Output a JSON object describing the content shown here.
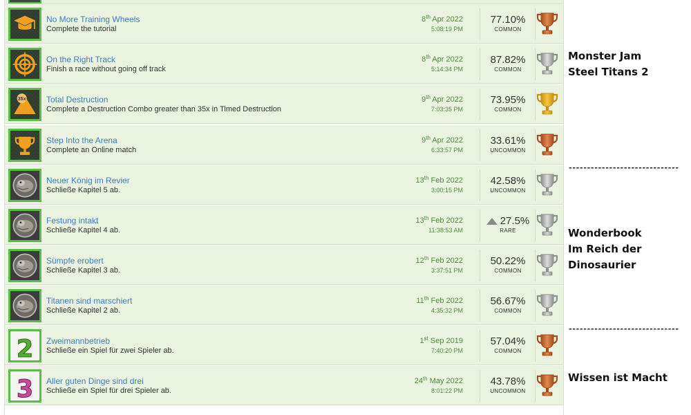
{
  "achievements": [
    {
      "title": "No More Training Wheels",
      "desc": "Complete the tutorial",
      "day": "8",
      "ord": "th",
      "monthyear": "Apr 2022",
      "time": "5:08:19 PM",
      "pct": "77.10%",
      "rarity": "COMMON",
      "trophy": "bronze",
      "icon": "hat-icon",
      "rare": false
    },
    {
      "title": "On the Right Track",
      "desc": "Finish a race without going off track",
      "day": "8",
      "ord": "th",
      "monthyear": "Apr 2022",
      "time": "5:14:34 PM",
      "pct": "87.82%",
      "rarity": "COMMON",
      "trophy": "silver",
      "icon": "target-icon",
      "rare": false
    },
    {
      "title": "Total Destruction",
      "desc": "Complete a Destruction Combo greater than 35x in Timed Destruction",
      "day": "9",
      "ord": "th",
      "monthyear": "Apr 2022",
      "time": "7:03:35 PM",
      "pct": "73.95%",
      "rarity": "COMMON",
      "trophy": "gold",
      "icon": "combo-35x-icon",
      "rare": false,
      "badge": "35x"
    },
    {
      "title": "Step Into the Arena",
      "desc": "Complete an Online match",
      "day": "9",
      "ord": "th",
      "monthyear": "Apr 2022",
      "time": "6:33:57 PM",
      "pct": "33.61%",
      "rarity": "UNCOMMON",
      "trophy": "bronze",
      "icon": "cup-icon",
      "rare": false
    },
    {
      "title": "Neuer König im Revier",
      "desc": "Schließe Kapitel 5 ab.",
      "day": "13",
      "ord": "th",
      "monthyear": "Feb 2022",
      "time": "3:00:15 PM",
      "pct": "42.58%",
      "rarity": "UNCOMMON",
      "trophy": "silver",
      "icon": "dinosaur-icon",
      "rare": false
    },
    {
      "title": "Festung intakt",
      "desc": "Schließe Kapitel 4 ab.",
      "day": "13",
      "ord": "th",
      "monthyear": "Feb 2022",
      "time": "11:38:53 AM",
      "pct": "27.5%",
      "rarity": "RARE",
      "trophy": "silver",
      "icon": "dinosaur-icon",
      "rare": true
    },
    {
      "title": "Sümpfe erobert",
      "desc": "Schließe Kapitel 3 ab.",
      "day": "12",
      "ord": "th",
      "monthyear": "Feb 2022",
      "time": "3:37:51 PM",
      "pct": "50.22%",
      "rarity": "COMMON",
      "trophy": "silver",
      "icon": "dinosaur-icon",
      "rare": false
    },
    {
      "title": "Titanen sind marschiert",
      "desc": "Schließe Kapitel 2 ab.",
      "day": "11",
      "ord": "th",
      "monthyear": "Feb 2022",
      "time": "4:35:32 PM",
      "pct": "56.67%",
      "rarity": "COMMON",
      "trophy": "silver",
      "icon": "dinosaur-icon",
      "rare": false
    },
    {
      "title": "Zweimannbetrieb",
      "desc": "Schließe ein Spiel für zwei Spieler ab.",
      "day": "1",
      "ord": "st",
      "monthyear": "Sep 2019",
      "time": "7:40:20 PM",
      "pct": "57.04%",
      "rarity": "COMMON",
      "trophy": "bronze",
      "icon": "number-2-icon",
      "rare": false,
      "badge": "2"
    },
    {
      "title": "Aller guten Dinge sind drei",
      "desc": "Schließe ein Spiel für drei Spieler ab.",
      "day": "24",
      "ord": "th",
      "monthyear": "May 2022",
      "time": "8:01:22 PM",
      "pct": "43.78%",
      "rarity": "UNCOMMON",
      "trophy": "bronze",
      "icon": "number-3-icon",
      "rare": false,
      "badge": "3"
    }
  ],
  "side": {
    "game1_line1": "Monster Jam",
    "game1_line2": "Steel Titans 2",
    "divider1": "------------------------------",
    "game2_line1": "Wonderbook",
    "game2_line2": "Im Reich der",
    "game2_line3": "Dinosaurier",
    "divider2": "------------------------------",
    "game3_line1": "Wissen ist Macht"
  },
  "colors": {
    "accent_green": "#5bbc49",
    "link_blue": "#3d7fbd",
    "row_bg": "#e9f3df",
    "gold": "#e0a81e",
    "silver": "#b0b0b0",
    "bronze": "#c8652f"
  }
}
